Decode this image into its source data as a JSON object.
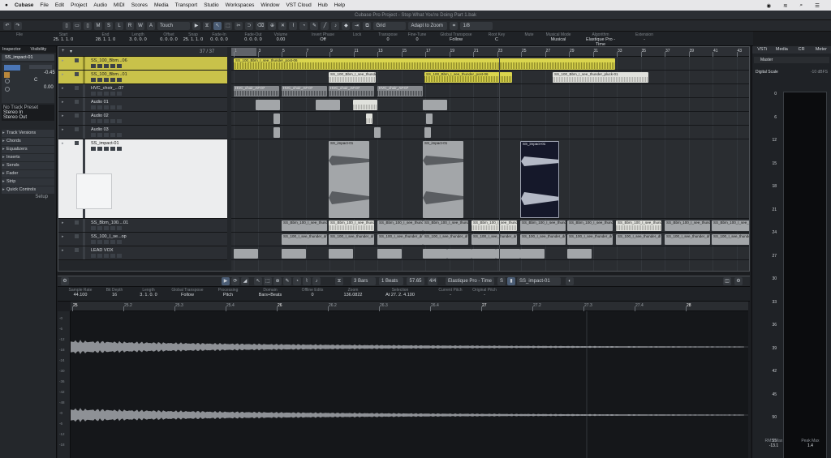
{
  "menubar": {
    "apple": "",
    "items": [
      "Cubase",
      "File",
      "Edit",
      "Project",
      "Audio",
      "MIDI",
      "Scores",
      "Media",
      "Transport",
      "Studio",
      "Workspaces",
      "Window",
      "VST Cloud",
      "Hub",
      "Help"
    ]
  },
  "window": {
    "title": "Cubase Pro Project - Stop What You're Doing Part 1.bak"
  },
  "toolbar": {
    "msrw": [
      "M",
      "S",
      "L",
      "R",
      "W",
      "A"
    ],
    "automation_mode": "Touch",
    "snap_mode": "Grid",
    "grid_type": "Adapt to Zoom",
    "quantize": "1/8"
  },
  "info_line": [
    {
      "label": "File",
      "value": ""
    },
    {
      "label": "Start",
      "value": "25. 1. 1.  0"
    },
    {
      "label": "End",
      "value": "28. 1. 1.  0"
    },
    {
      "label": "Length",
      "value": "3. 0. 0.  0"
    },
    {
      "label": "Offset",
      "value": "0. 0. 0.  0"
    },
    {
      "label": "Snap",
      "value": "25. 1. 1.  0"
    },
    {
      "label": "Fade-In",
      "value": "0. 0. 0.  0"
    },
    {
      "label": "Fade-Out",
      "value": "0. 0. 0.  0"
    },
    {
      "label": "Volume",
      "value": "0.00"
    },
    {
      "label": "Invert Phase",
      "value": "Off"
    },
    {
      "label": "Lock",
      "value": ""
    },
    {
      "label": "Transpose",
      "value": "0"
    },
    {
      "label": "Fine-Tune",
      "value": "0"
    },
    {
      "label": "Global Transpose",
      "value": "Follow"
    },
    {
      "label": "Root Key",
      "value": "C"
    },
    {
      "label": "Mute",
      "value": ""
    },
    {
      "label": "Musical Mode",
      "value": "Musical"
    },
    {
      "label": "Algorithm",
      "value": "Elastique Pro - Time"
    },
    {
      "label": "Extension",
      "value": "-"
    }
  ],
  "inspector": {
    "tabs": [
      "Inspector",
      "Visibility"
    ],
    "track_name": "SS_impact-01",
    "volume": "-0.45",
    "pan": "C",
    "delay": "0.00",
    "routing": [
      "No Track Preset",
      "Stereo In",
      "Stereo Out"
    ],
    "sections": [
      "Track Versions",
      "Chords",
      "Equalizers",
      "Inserts",
      "Sends",
      "Fader",
      "Strip",
      "Quick Controls"
    ],
    "setup": "Setup"
  },
  "ruler": {
    "position": "37 / 37",
    "bars": [
      "1",
      "3",
      "5",
      "7",
      "9",
      "11",
      "13",
      "15",
      "17",
      "19",
      "21",
      "23",
      "25",
      "27",
      "29",
      "31",
      "33",
      "35",
      "37",
      "39",
      "41",
      "43"
    ]
  },
  "tracks": [
    {
      "name": "SS_100_Bbm...06",
      "style": "yellow"
    },
    {
      "name": "SS_100_Bbm...01",
      "style": "yellow"
    },
    {
      "name": "HVC_choir_...07",
      "style": "normal"
    },
    {
      "name": "Audio 01",
      "style": "normal"
    },
    {
      "name": "Audio 02",
      "style": "normal"
    },
    {
      "name": "Audio 03",
      "style": "normal"
    },
    {
      "name": "SS_impact-01",
      "style": "sel"
    },
    {
      "name": "SS_Bbm_100....01",
      "style": "normal"
    },
    {
      "name": "SS_100_I_se...op",
      "style": "normal"
    },
    {
      "name": "LEAD VOX",
      "style": "normal"
    }
  ],
  "events": {
    "yellow_main": "SS_100_Bbm_I_see_thunder_post-06",
    "yellow_upper": "SS_100_Bbm_I_see_thunder_post-06",
    "yellow_lower": "SS_100_Bbm_I_see_thunder_pluck-01",
    "white_clip": "SS_100_Bbm_I_see_thunder_pluck-01",
    "choir": "HVC_choir_A#-07",
    "impact": "SS_impact-01",
    "bass_loop": "SS_Bbm_100_I_see_thunder_sub_loop-01",
    "drum_loop": "SS_100_I_see_thunder_drum_loop"
  },
  "right_panel": {
    "tabs": [
      "VSTi",
      "Media",
      "CR",
      "Meter"
    ],
    "section": "Master",
    "digital_scale": "Digital Scale",
    "digital_value": "-10 dBFS",
    "scale": [
      "0",
      "6",
      "12",
      "15",
      "18",
      "21",
      "24",
      "27",
      "30",
      "33",
      "36",
      "39",
      "42",
      "45",
      "50",
      "55",
      "60"
    ],
    "rms_label": "RMS Max",
    "rms_value": "-13.1",
    "peak_label": "Peak Max",
    "peak_value": "1.4"
  },
  "lower_zone": {
    "bars_field": "3 Bars",
    "beats_field": "1 Beats",
    "tempo": "57.65",
    "signature": "4/4",
    "algorithm": "Elastique Pro - Time",
    "event_name": "SS_impact-01",
    "info": [
      {
        "label": "Sample Rate",
        "value": "44.100"
      },
      {
        "label": "Bit Depth",
        "value": "16"
      },
      {
        "label": "Length",
        "value": "3. 1. 0.  0"
      },
      {
        "label": "Global Transpose",
        "value": "Follow"
      },
      {
        "label": "Processing",
        "value": "Pitch"
      },
      {
        "label": "Domain",
        "value": "Bars+Beats"
      },
      {
        "label": "Offline Edits",
        "value": "0"
      },
      {
        "label": "Zoom",
        "value": "136.0822"
      },
      {
        "label": "Selection",
        "value": "At 27. 2. 4.100"
      },
      {
        "label": "Current Pitch",
        "value": "-"
      },
      {
        "label": "Original Pitch",
        "value": "-"
      }
    ],
    "ruler_marks": [
      "25",
      "25.2",
      "25.3",
      "25.4",
      "26",
      "26.2",
      "26.3",
      "26.4",
      "27",
      "27.2",
      "27.3",
      "27.4",
      "28"
    ],
    "scale": [
      "-0",
      "-6",
      "-12",
      "-18",
      "-24",
      "-30",
      "-36",
      "-42",
      "-48",
      "-0",
      "-6",
      "-12",
      "-18"
    ]
  },
  "colors": {
    "accent_yellow": "#dad54d",
    "selection_white": "#ecedee",
    "background": "#1b1d20"
  }
}
